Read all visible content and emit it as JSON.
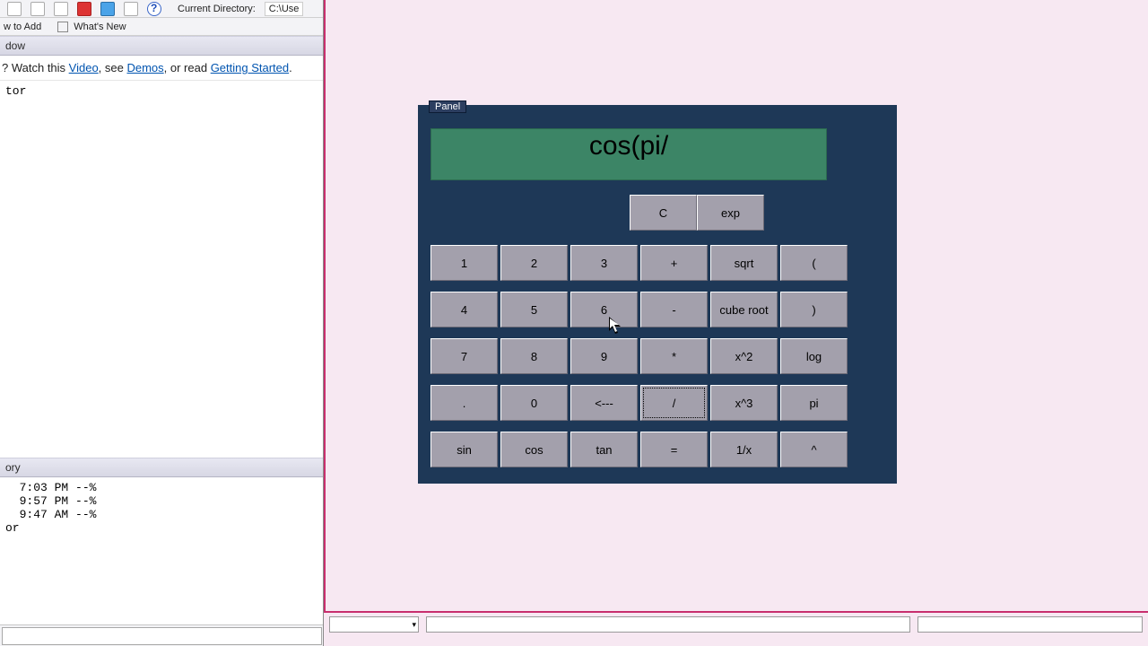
{
  "host": {
    "dir_label": "Current Directory:",
    "dir_value": "C:\\Use",
    "shortcuts_bar_left": "w to Add",
    "shortcuts_bar_right": "What's New",
    "window_bar": "dow",
    "help_prefix": "? Watch this ",
    "help_link_video": "Video",
    "help_mid1": ", see ",
    "help_link_demos": "Demos",
    "help_mid2": ", or read ",
    "help_link_gs": "Getting Started",
    "help_suffix": ".",
    "cmd_first_line": "tor",
    "history_bar": "ory",
    "history_lines": [
      "  7:03 PM --%",
      "  9:57 PM --%",
      "  9:47 AM --%",
      "or"
    ],
    "bottom_line": "or"
  },
  "panel": {
    "tab": "Panel"
  },
  "calc": {
    "display": "cos(pi/",
    "top": {
      "clear": "C",
      "exp": "exp"
    },
    "rows": [
      [
        "1",
        "2",
        "3",
        "+",
        "sqrt",
        "("
      ],
      [
        "4",
        "5",
        "6",
        "-",
        "cube root",
        ")"
      ],
      [
        "7",
        "8",
        "9",
        "*",
        "x^2",
        "log"
      ],
      [
        ".",
        "0",
        "<---",
        "/",
        "x^3",
        "pi"
      ],
      [
        "sin",
        "cos",
        "tan",
        "=",
        "1/x",
        "^"
      ]
    ]
  }
}
